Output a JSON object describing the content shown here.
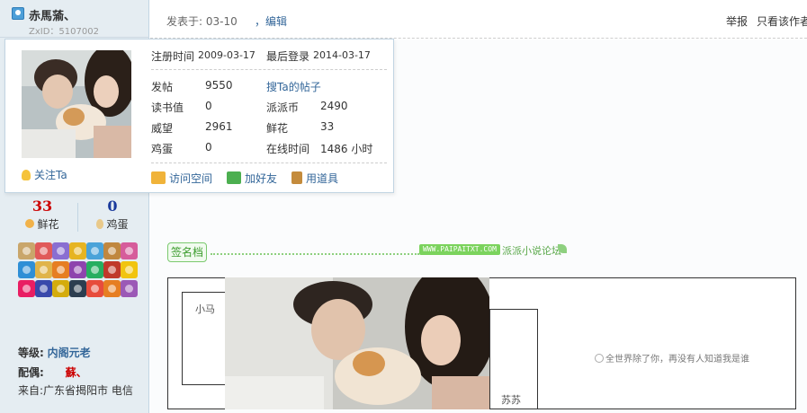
{
  "user": {
    "name": "赤馬蕍、",
    "zxid": "ZxID：5107002"
  },
  "popup": {
    "register_label": "注册时间",
    "register_value": "2009-03-17",
    "last_login_label": "最后登录",
    "last_login_value": "2014-03-17",
    "posts_label": "发帖",
    "posts_value": "9550",
    "search_posts": "搜Ta的帖子",
    "reading_label": "读书值",
    "reading_value": "0",
    "paipai_label": "派派币",
    "paipai_value": "2490",
    "prestige_label": "威望",
    "prestige_value": "2961",
    "flowers_label": "鲜花",
    "flowers_value": "33",
    "eggs_label": "鸡蛋",
    "eggs_value": "0",
    "online_label": "在线时间",
    "online_value": "1486 小时",
    "follow": "关注Ta",
    "visit_space": "访问空间",
    "add_friend": "加好友",
    "use_item": "用道具"
  },
  "stats": {
    "flowers_num": "33",
    "flowers_label": "鲜花",
    "eggs_num": "0",
    "eggs_label": "鸡蛋"
  },
  "profile_lines": {
    "level_key": "等级:",
    "level_val": "内阁元老",
    "spouse_key": "配偶:",
    "spouse_val": "蘇、",
    "from_label": "来自:广东省揭阳市 电信"
  },
  "post_header": {
    "time": "发表于: 03-10",
    "edit": "，编辑",
    "report": "举报",
    "only_author": "只看该作者"
  },
  "signature": {
    "tag": "签名档",
    "site": "WWW.PAIPAITXT.COM",
    "forum": "派派小说论坛",
    "name_left": "小马",
    "name_right": "苏苏",
    "quote": "全世界除了你，再没有人知道我是谁"
  },
  "colors": {
    "sidebar_bg": "#e5edf2",
    "link": "#336699",
    "flower_red": "#cc0000",
    "egg_blue": "#1a3a9c",
    "spouse_red": "#cc0000",
    "sig_green": "#7bc96f"
  },
  "icons": {
    "user": "user-icon",
    "follow": "lightbulb-icon",
    "visit_space": "home-icon",
    "add_friend": "people-icon",
    "use_item": "wand-icon",
    "flower": "flower-icon",
    "egg": "egg-icon",
    "quote": "quote-icon"
  },
  "medals": [
    "#c9a66b",
    "#e05a5a",
    "#8a6fd1",
    "#e6b422",
    "#4aa3d9",
    "#c0873f",
    "#d65c9b",
    "#2f8fd6",
    "#e0b44a",
    "#e67e22",
    "#8e44ad",
    "#27ae60",
    "#c0392b",
    "#f1c40f",
    "#e91e63",
    "#3949ab",
    "#d4ac0d",
    "#2c3e50",
    "#e74c3c",
    "#e67e22",
    "#9b59b6"
  ]
}
